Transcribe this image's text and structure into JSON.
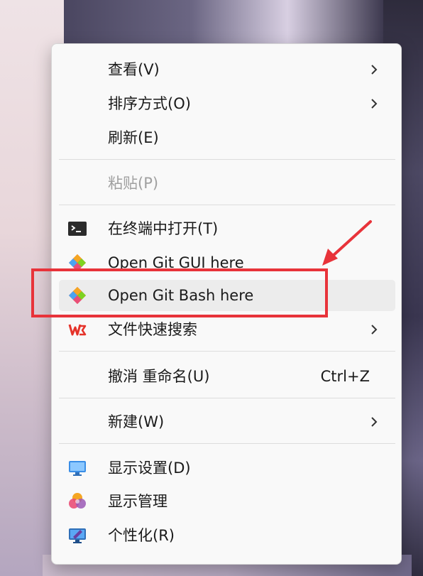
{
  "menu": {
    "items": [
      {
        "label": "查看(V)",
        "submenu": true
      },
      {
        "label": "排序方式(O)",
        "submenu": true
      },
      {
        "label": "刷新(E)"
      },
      {
        "label": "粘贴(P)",
        "disabled": true
      },
      {
        "label": "在终端中打开(T)",
        "icon": "terminal-icon"
      },
      {
        "label": "Open Git GUI here",
        "icon": "git-icon"
      },
      {
        "label": "Open Git Bash here",
        "icon": "git-icon",
        "highlighted": true
      },
      {
        "label": "文件快速搜索",
        "icon": "wps-icon",
        "submenu": true
      },
      {
        "label": "撤消 重命名(U)",
        "shortcut": "Ctrl+Z"
      },
      {
        "label": "新建(W)",
        "submenu": true
      },
      {
        "label": "显示设置(D)",
        "icon": "display-icon"
      },
      {
        "label": "显示管理",
        "icon": "color-palette-icon"
      },
      {
        "label": "个性化(R)",
        "icon": "personalize-icon"
      }
    ]
  },
  "annotation": {
    "box_color": "#e8333a",
    "arrow_color": "#e8333a"
  }
}
